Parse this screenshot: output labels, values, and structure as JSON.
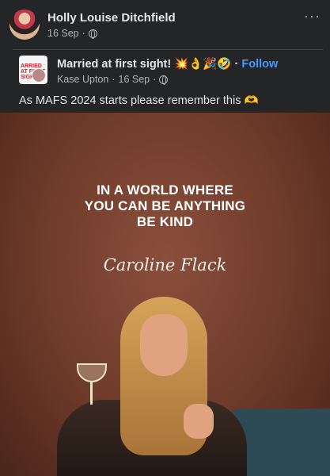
{
  "post": {
    "author": "Holly Louise Ditchfield",
    "date": "16 Sep",
    "separator": "·",
    "more": "···"
  },
  "shared": {
    "page_name": "Married at first sight! 💥👌🎉🤣",
    "follow_label": "Follow",
    "sub_author": "Kase Upton",
    "sub_date": "16 Sep",
    "caption": "As MAFS 2024 starts please remember this 🫶",
    "thumb_text": "ARRIED AT FIRST SIGHT"
  },
  "image": {
    "quote_line1": "IN A WORLD WHERE",
    "quote_line2": "YOU CAN BE ANYTHING",
    "quote_line3": "BE KIND",
    "signature": "Caroline Flack"
  }
}
